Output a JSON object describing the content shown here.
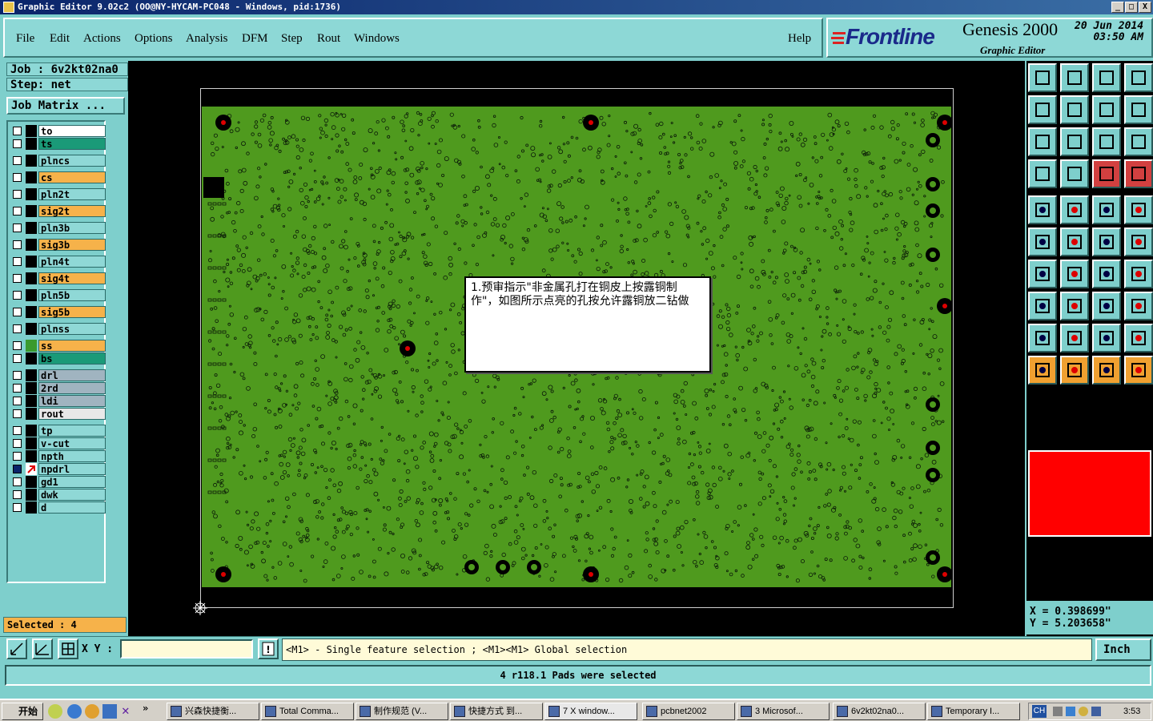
{
  "window": {
    "title": "Graphic Editor 9.02c2 (OO@NY-HYCAM-PC048 - Windows, pid:1736)",
    "min": "_",
    "max": "□",
    "close": "X"
  },
  "menu": {
    "file": "File",
    "edit": "Edit",
    "actions": "Actions",
    "options": "Options",
    "analysis": "Analysis",
    "dfm": "DFM",
    "step": "Step",
    "rout": "Rout",
    "windows": "Windows",
    "help": "Help"
  },
  "brand": {
    "logo": "Frontline",
    "product": "Genesis 2000",
    "subtitle": "Graphic Editor",
    "date": "20 Jun 2014",
    "time": "03:50 AM"
  },
  "job": {
    "job_label": "Job : 6v2kt02na0",
    "step_label": "Step: net",
    "matrix_button": "Job Matrix ..."
  },
  "layers": [
    {
      "name": "to",
      "color": "#ffffff"
    },
    {
      "name": "ts",
      "color": "#1a9a78"
    },
    {
      "name": "plncs",
      "color": "#8fd8d6"
    },
    {
      "name": "cs",
      "color": "#f6b24a"
    },
    {
      "name": "pln2t",
      "color": "#8fd8d6"
    },
    {
      "name": "sig2t",
      "color": "#f6b24a"
    },
    {
      "name": "pln3b",
      "color": "#8fd8d6"
    },
    {
      "name": "sig3b",
      "color": "#f6b24a"
    },
    {
      "name": "pln4t",
      "color": "#8fd8d6"
    },
    {
      "name": "sig4t",
      "color": "#f6b24a"
    },
    {
      "name": "pln5b",
      "color": "#8fd8d6"
    },
    {
      "name": "sig5b",
      "color": "#f6b24a"
    },
    {
      "name": "plnss",
      "color": "#8fd8d6"
    },
    {
      "name": "ss",
      "color": "#f6b24a"
    },
    {
      "name": "bs",
      "color": "#1a9a78"
    },
    {
      "name": "drl",
      "color": "#a0b4c0"
    },
    {
      "name": "2rd",
      "color": "#a0b4c0"
    },
    {
      "name": "ldi",
      "color": "#a0b4c0"
    },
    {
      "name": "rout",
      "color": "#e8e8e8"
    },
    {
      "name": "tp",
      "color": "#8fd8d6"
    },
    {
      "name": "v-cut",
      "color": "#8fd8d6"
    },
    {
      "name": "npth",
      "color": "#8fd8d6"
    },
    {
      "name": "npdrl",
      "color": "#8fd8d6"
    },
    {
      "name": "gd1",
      "color": "#8fd8d6"
    },
    {
      "name": "dwk",
      "color": "#8fd8d6"
    },
    {
      "name": "d",
      "color": "#8fd8d6"
    }
  ],
  "selected_count": "Selected : 4",
  "note_text": "1.预审指示\"非金属孔打在铜皮上按露铜制作\"，如图所示点亮的孔按允许露铜放二钻做",
  "coords": {
    "x": "X = 0.398699\"",
    "y": "Y = 5.203658\""
  },
  "command": {
    "xy_label": "X Y :",
    "xy_value": "",
    "hint": "<M1> - Single feature selection ; <M1><M1> Global selection",
    "units": "Inch"
  },
  "status_message": "4 r118.1 Pads were selected",
  "taskbar": {
    "start": "开始",
    "tasks": [
      "兴森快捷衡...",
      "Total Comma...",
      "制作规范 (V...",
      "快捷方式 到...",
      "7 X window...",
      "pcbnet2002",
      "3 Microsof...",
      "6v2kt02na0...",
      "Temporary I..."
    ],
    "lang": "CH",
    "clock": "3:53"
  },
  "colors": {
    "board": "#4f9a1e",
    "panel": "#7ecfcc",
    "highlight": "#ff0000"
  }
}
